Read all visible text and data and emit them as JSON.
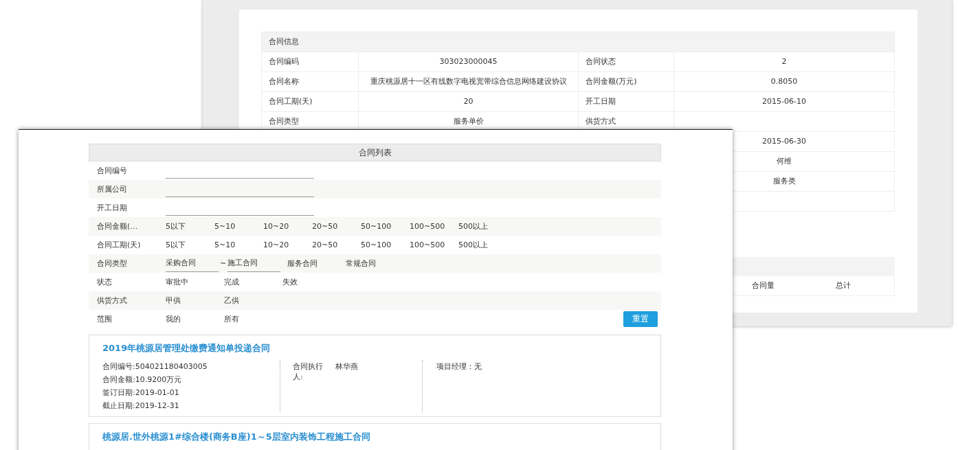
{
  "back_window": {
    "info_table": {
      "title": "合同信息",
      "rows": [
        {
          "label": "合同编码",
          "value": "303023000045",
          "label_2": "合同状态",
          "value_2": "2"
        },
        {
          "label": "合同名称",
          "value": "重庆桃源居十一区有线数字电视宽带综合信息网络建设协议",
          "label_2": "合同金额(万元)",
          "value_2": "0.8050"
        },
        {
          "label": "合同工期(天)",
          "value": "20",
          "label_2": "开工日期",
          "value_2": "2015-06-10"
        },
        {
          "label": "合同类型",
          "value": "服务单价",
          "label_2": "供货方式"
        },
        {
          "value_2": "2015-06-30"
        },
        {
          "value_2": "何维"
        },
        {
          "value_2": "服务类"
        }
      ]
    },
    "summary_table": {
      "columns": [
        "合同量",
        "总计"
      ]
    }
  },
  "front_window": {
    "title": "合同列表",
    "filters": [
      {
        "kind": "text",
        "label": "合同编号"
      },
      {
        "kind": "text",
        "label": "所属公司"
      },
      {
        "kind": "text",
        "label": "开工日期"
      },
      {
        "kind": "range",
        "label": "合同金额(…",
        "options": [
          {
            "kind": "option",
            "label": "5以下"
          },
          {
            "kind": "option",
            "label": "5~10"
          },
          {
            "kind": "option",
            "label": "10~20"
          },
          {
            "kind": "option",
            "label": "20~50"
          },
          {
            "kind": "option",
            "label": "50~100"
          },
          {
            "kind": "option",
            "label": "100~500"
          },
          {
            "kind": "option",
            "label": "500以上"
          }
        ]
      },
      {
        "kind": "range",
        "label": "合同工期(天)",
        "options": [
          {
            "kind": "option",
            "label": "5以下"
          },
          {
            "kind": "option",
            "label": "5~10"
          },
          {
            "kind": "option",
            "label": "10~20"
          },
          {
            "kind": "option",
            "label": "20~50"
          },
          {
            "kind": "option",
            "label": "50~100"
          },
          {
            "kind": "option",
            "label": "100~500"
          },
          {
            "kind": "option",
            "label": "500以上"
          }
        ]
      },
      {
        "kind": "choice",
        "label": "合同类型",
        "options": [
          {
            "kind": "field",
            "label": "采购合同"
          },
          {
            "kind": "separator",
            "label": "~"
          },
          {
            "kind": "field",
            "label": "施工合同"
          },
          {
            "kind": "option",
            "label": "服务合同"
          },
          {
            "kind": "option",
            "label": "常规合同"
          }
        ]
      },
      {
        "kind": "choice",
        "label": "状态",
        "options": [
          {
            "kind": "option",
            "label": "审批中"
          },
          {
            "kind": "option",
            "label": "完成"
          },
          {
            "kind": "option",
            "label": "失效"
          }
        ]
      },
      {
        "kind": "choice",
        "label": "供货方式",
        "options": [
          {
            "kind": "option",
            "label": "甲供"
          },
          {
            "kind": "option",
            "label": "乙供"
          }
        ]
      },
      {
        "kind": "choice",
        "label": "范围",
        "options": [
          {
            "kind": "option",
            "label": "我的"
          },
          {
            "kind": "option",
            "label": "所有"
          }
        ]
      }
    ],
    "reset_button": "重置",
    "contracts": [
      {
        "title": "2019年桃源居管理处缴费通知单投递合同",
        "details": [
          "合同编号:504021180403005",
          "合同金额:10.9200万元",
          "签订日期:2019-01-01",
          "截止日期:2019-12-31"
        ],
        "executor_label": "合同执行人:",
        "executor": "林华燕",
        "manager": "项目经理：无"
      },
      {
        "title": "桃源居.世外桃源1#综合楼(商务B座)1～5层室内装饰工程施工合同"
      }
    ]
  }
}
